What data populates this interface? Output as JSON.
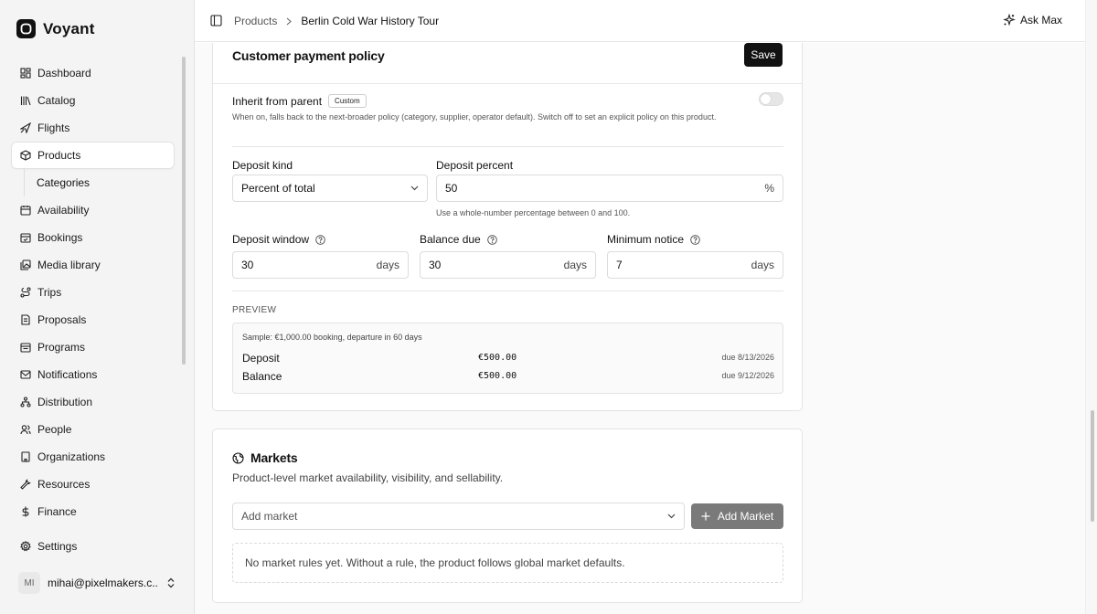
{
  "app": {
    "name": "Voyant"
  },
  "sidebar": {
    "items": [
      {
        "label": "Dashboard",
        "icon": "dashboard-icon"
      },
      {
        "label": "Catalog",
        "icon": "catalog-icon"
      },
      {
        "label": "Flights",
        "icon": "plane-icon"
      },
      {
        "label": "Products",
        "icon": "package-icon",
        "active": true
      },
      {
        "label": "Categories",
        "sub": true
      },
      {
        "label": "Availability",
        "icon": "calendar-icon"
      },
      {
        "label": "Bookings",
        "icon": "calendar-check-icon"
      },
      {
        "label": "Media library",
        "icon": "images-icon"
      },
      {
        "label": "Trips",
        "icon": "route-icon"
      },
      {
        "label": "Proposals",
        "icon": "file-icon"
      },
      {
        "label": "Programs",
        "icon": "calendar-range-icon"
      },
      {
        "label": "Notifications",
        "icon": "mail-icon"
      },
      {
        "label": "Distribution",
        "icon": "network-icon"
      },
      {
        "label": "People",
        "icon": "users-icon"
      },
      {
        "label": "Organizations",
        "icon": "building-icon"
      },
      {
        "label": "Resources",
        "icon": "wrench-icon"
      },
      {
        "label": "Finance",
        "icon": "dollar-icon"
      }
    ],
    "settings_label": "Settings",
    "user": {
      "initials": "MI",
      "email": "mihai@pixelmakers.c..."
    }
  },
  "topbar": {
    "breadcrumb_root": "Products",
    "breadcrumb_current": "Berlin Cold War History Tour",
    "ask_label": "Ask Max"
  },
  "policy": {
    "title": "Customer payment policy",
    "save_label": "Save",
    "inherit_label": "Inherit from parent",
    "inherit_badge": "Custom",
    "inherit_on": false,
    "inherit_help": "When on, falls back to the next-broader policy (category, supplier, operator default). Switch off to set an explicit policy on this product.",
    "deposit_kind_label": "Deposit kind",
    "deposit_kind_value": "Percent of total",
    "deposit_percent_label": "Deposit percent",
    "deposit_percent_value": "50",
    "deposit_percent_unit": "%",
    "deposit_percent_hint": "Use a whole-number percentage between 0 and 100.",
    "deposit_window_label": "Deposit window",
    "deposit_window_value": "30",
    "balance_due_label": "Balance due",
    "balance_due_value": "30",
    "minimum_notice_label": "Minimum notice",
    "minimum_notice_value": "7",
    "days_unit": "days",
    "preview_label": "PREVIEW",
    "preview_sample": "Sample: €1,000.00 booking, departure in 60 days",
    "preview_rows": [
      {
        "label": "Deposit",
        "amount": "€500.00",
        "due": "due 8/13/2026"
      },
      {
        "label": "Balance",
        "amount": "€500.00",
        "due": "due 9/12/2026"
      }
    ]
  },
  "markets": {
    "title": "Markets",
    "description": "Product-level market availability, visibility, and sellability.",
    "select_placeholder": "Add market",
    "add_button_label": "Add Market",
    "empty_text": "No market rules yet. Without a rule, the product follows global market defaults."
  }
}
